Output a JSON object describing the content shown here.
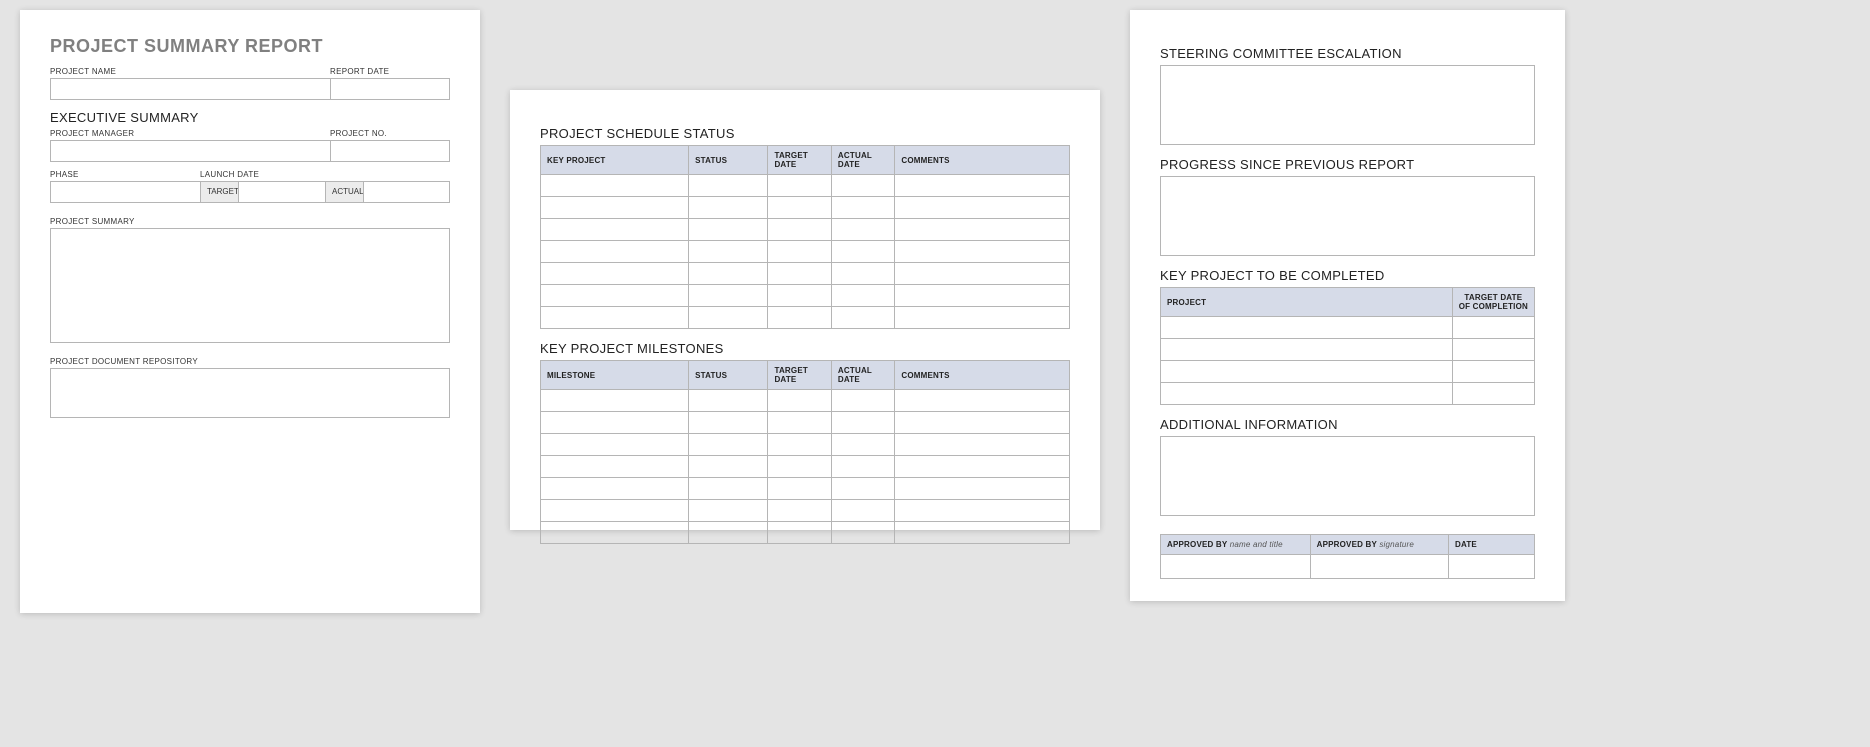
{
  "page1": {
    "title": "PROJECT SUMMARY REPORT",
    "labels": {
      "project_name": "PROJECT NAME",
      "report_date": "REPORT DATE",
      "exec_summary": "EXECUTIVE SUMMARY",
      "project_manager": "PROJECT MANAGER",
      "project_no": "PROJECT NO.",
      "phase": "PHASE",
      "launch_date": "LAUNCH DATE",
      "target": "TARGET",
      "actual": "ACTUAL",
      "project_summary": "PROJECT SUMMARY",
      "repo": "PROJECT DOCUMENT REPOSITORY"
    }
  },
  "page2": {
    "schedule_title": "PROJECT SCHEDULE STATUS",
    "schedule_headers": {
      "key_project": "KEY PROJECT",
      "status": "STATUS",
      "target_date": "TARGET DATE",
      "actual_date": "ACTUAL DATE",
      "comments": "COMMENTS"
    },
    "milestones_title": "KEY PROJECT MILESTONES",
    "milestones_headers": {
      "milestone": "MILESTONE",
      "status": "STATUS",
      "target_date": "TARGET DATE",
      "actual_date": "ACTUAL DATE",
      "comments": "COMMENTS"
    }
  },
  "page3": {
    "steering_title": "STEERING COMMITTEE ESCALATION",
    "progress_title": "PROGRESS SINCE PREVIOUS REPORT",
    "key_project_title": "KEY PROJECT TO BE COMPLETED",
    "kpc_headers": {
      "project": "PROJECT",
      "target_completion": "TARGET DATE OF COMPLETION"
    },
    "additional_title": "ADDITIONAL INFORMATION",
    "approval_headers": {
      "approved_by_name": "APPROVED BY",
      "name_hint": "name and title",
      "approved_by_sig": "APPROVED BY",
      "sig_hint": "signature",
      "date": "DATE"
    }
  }
}
